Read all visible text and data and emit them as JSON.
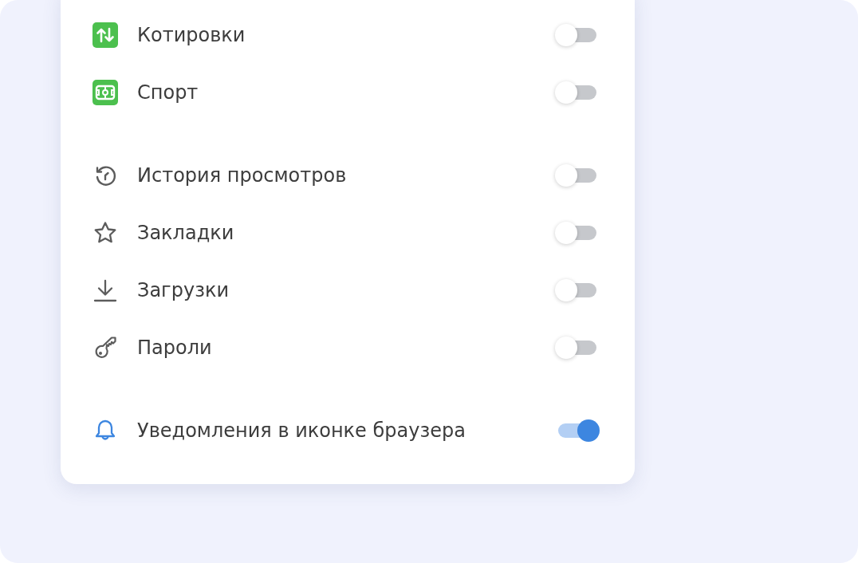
{
  "groups": [
    {
      "items": [
        {
          "kind": "quotes",
          "label": "Котировки",
          "on": false
        },
        {
          "kind": "sport",
          "label": "Спорт",
          "on": false
        }
      ]
    },
    {
      "items": [
        {
          "kind": "history",
          "label": "История просмотров",
          "on": false
        },
        {
          "kind": "bookmarks",
          "label": "Закладки",
          "on": false
        },
        {
          "kind": "downloads",
          "label": "Загрузки",
          "on": false
        },
        {
          "kind": "passwords",
          "label": "Пароли",
          "on": false
        }
      ]
    },
    {
      "items": [
        {
          "kind": "notifications",
          "label": "Уведомления в иконке браузера",
          "on": true
        }
      ]
    }
  ]
}
